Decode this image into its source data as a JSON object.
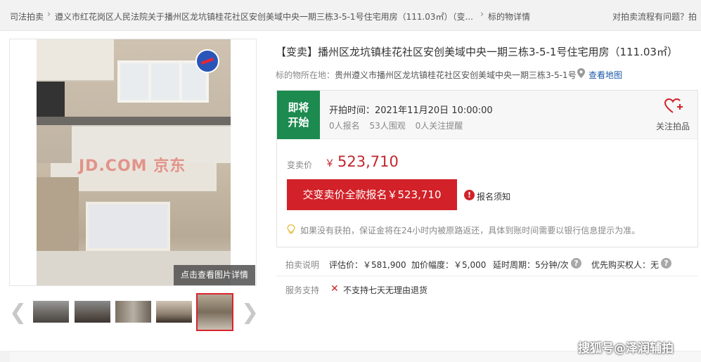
{
  "breadcrumb": {
    "items": [
      "司法拍卖",
      "遵义市红花岗区人民法院关于播州区龙坑镇桂花社区安创美域中央一期三栋3-5-1号住宅用房（111.03㎡）（变...",
      "标的物详情"
    ],
    "help": "对拍卖流程有问题？拍"
  },
  "gallery": {
    "watermark": "JD.COM 京东",
    "view_detail": "点击查看图片详情",
    "prev_icon": "chevron-left-icon",
    "next_icon": "chevron-right-icon"
  },
  "item": {
    "title": "【变卖】播州区龙坑镇桂花社区安创美域中央一期三栋3-5-1号住宅用房（111.03㎡）",
    "location_label": "标的物所在地：",
    "location_value": "贵州遵义市播州区龙坑镇桂花社区安创美域中央一期三栋3-5-1号",
    "map_link": "查看地图"
  },
  "auction": {
    "status": "即将开始",
    "status_line1": "即将",
    "status_line2": "开始",
    "start_time": "开拍时间：2021年11月20日 10:00:00",
    "signups": "0人报名",
    "watchers": "53人围观",
    "reminders": "0人关注提醒",
    "follow_label": "关注拍品",
    "price_label": "变卖价",
    "currency": "￥",
    "price": "523,710",
    "pay_button": "交变卖价全款报名￥523,710",
    "notice_link": "报名须知",
    "tip": "如果没有获拍，保证金将在24小时内被原路返还，具体到账时间需要以银行信息提示为准。",
    "accent_color": "#d22128",
    "status_color": "#1d8a4f"
  },
  "info": {
    "desc_label": "拍卖说明",
    "appraisal": "评估价：￥581,900",
    "increment": "加价幅度：￥5,000",
    "delay": "延时周期：5分钟/次",
    "priority": "优先购买权人：无",
    "service_label": "服务支持",
    "service_value": "不支持七天无理由退货"
  },
  "footer_watermark": "搜狐号@泽润辅拍"
}
